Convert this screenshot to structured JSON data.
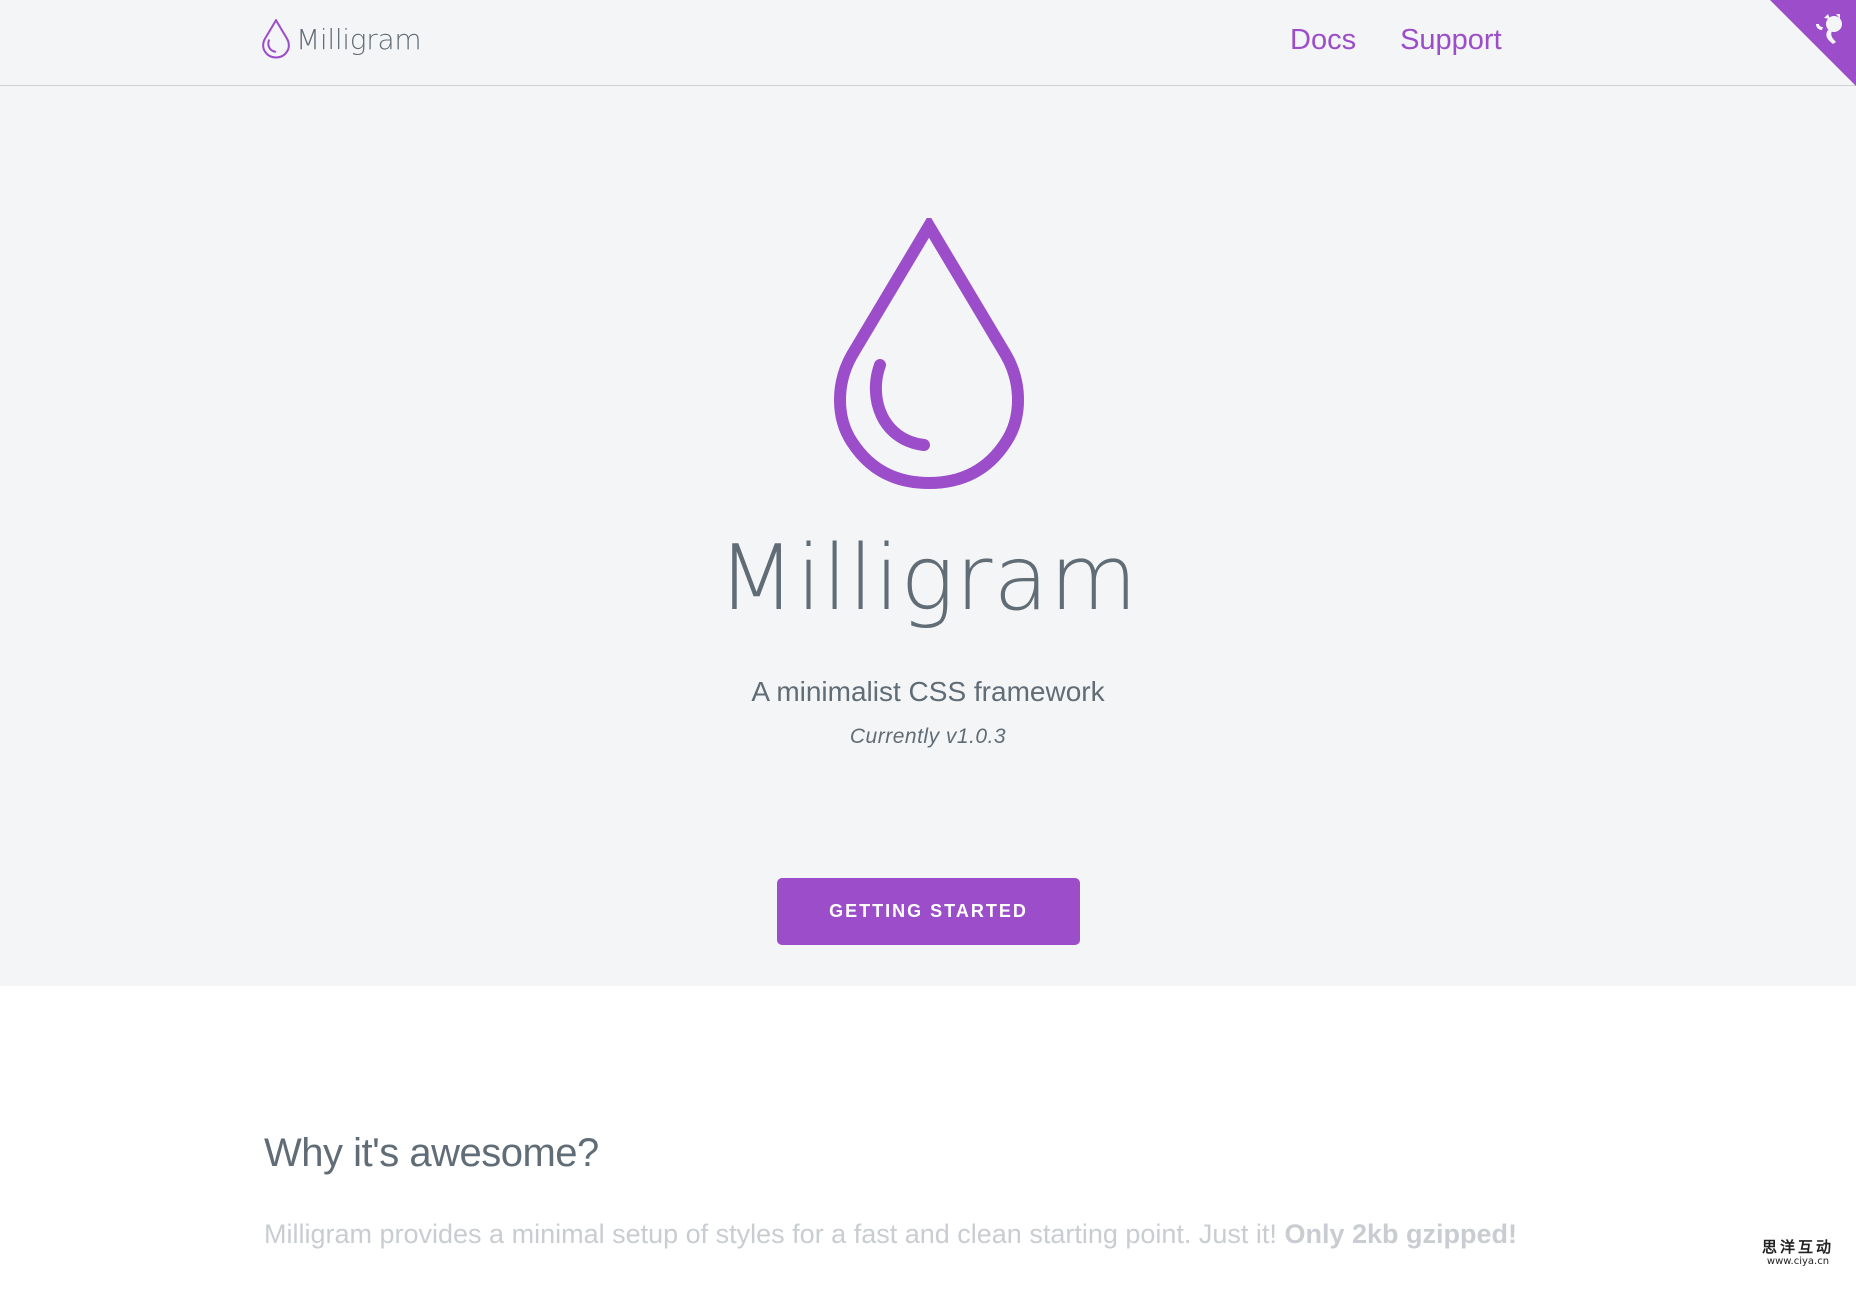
{
  "nav": {
    "brand": "Milligram",
    "links": [
      "Docs",
      "Support"
    ]
  },
  "hero": {
    "title": "Milligram",
    "subtitle": "A minimalist CSS framework",
    "version": "Currently v1.0.3",
    "button_label": "GETTING STARTED"
  },
  "section": {
    "title": "Why it's awesome?",
    "text": "Milligram provides a minimal setup of styles for a fast and clean starting point. Just it!",
    "text_bold": "Only 2kb gzipped!"
  },
  "watermark": {
    "cn": "思洋互动",
    "url": "www.ciya.cn"
  },
  "colors": {
    "accent": "#9b4dca",
    "text": "#606c76",
    "hero_bg": "#f4f5f6"
  },
  "icons": {
    "brand": "droplet-icon",
    "corner": "github-octocat-icon"
  }
}
